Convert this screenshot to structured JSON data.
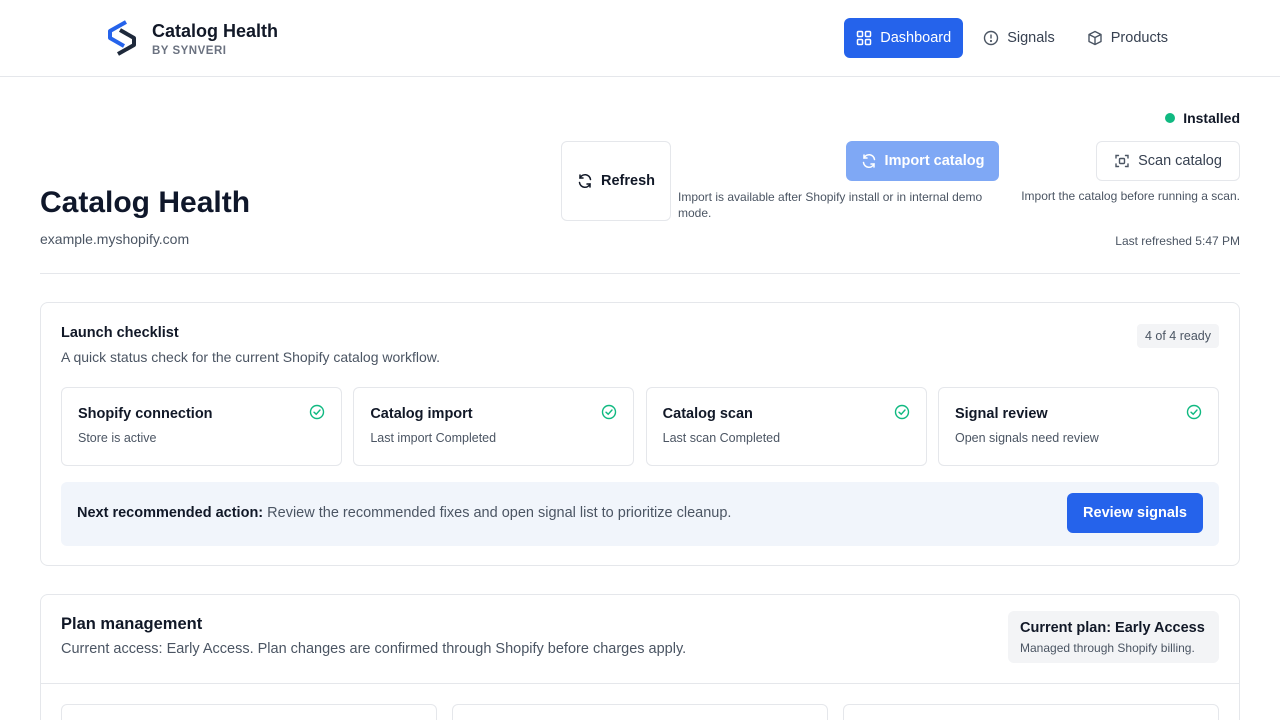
{
  "brand": {
    "title": "Catalog Health",
    "subtitle": "BY SYNVERI"
  },
  "nav": {
    "items": [
      {
        "label": "Dashboard",
        "icon": "grid-icon",
        "active": true
      },
      {
        "label": "Signals",
        "icon": "alert-circle-icon",
        "active": false
      },
      {
        "label": "Products",
        "icon": "package-icon",
        "active": false
      }
    ]
  },
  "header": {
    "title": "Catalog Health",
    "store": "example.myshopify.com",
    "status": "Installed",
    "status_color": "#10b981",
    "refresh_label": "Refresh",
    "import_label": "Import catalog",
    "import_help": "Import is available after Shopify install or in internal demo mode.",
    "scan_label": "Scan catalog",
    "scan_help": "Import the catalog before running a scan.",
    "last_refreshed": "Last refreshed 5:47 PM"
  },
  "checklist": {
    "title": "Launch checklist",
    "description": "A quick status check for the current Shopify catalog workflow.",
    "badge": "4 of 4 ready",
    "steps": [
      {
        "title": "Shopify connection",
        "desc": "Store is active"
      },
      {
        "title": "Catalog import",
        "desc": "Last import Completed"
      },
      {
        "title": "Catalog scan",
        "desc": "Last scan Completed"
      },
      {
        "title": "Signal review",
        "desc": "Open signals need review"
      }
    ],
    "next_label": "Next recommended action:",
    "next_text": "Review the recommended fixes and open signal list to prioritize cleanup.",
    "review_button": "Review signals"
  },
  "plan": {
    "title": "Plan management",
    "description": "Current access: Early Access. Plan changes are confirmed through Shopify before charges apply.",
    "current_plan": "Current plan: Early Access",
    "current_plan_sub": "Managed through Shopify billing."
  },
  "colors": {
    "accent": "#2563eb",
    "success": "#10b981"
  }
}
